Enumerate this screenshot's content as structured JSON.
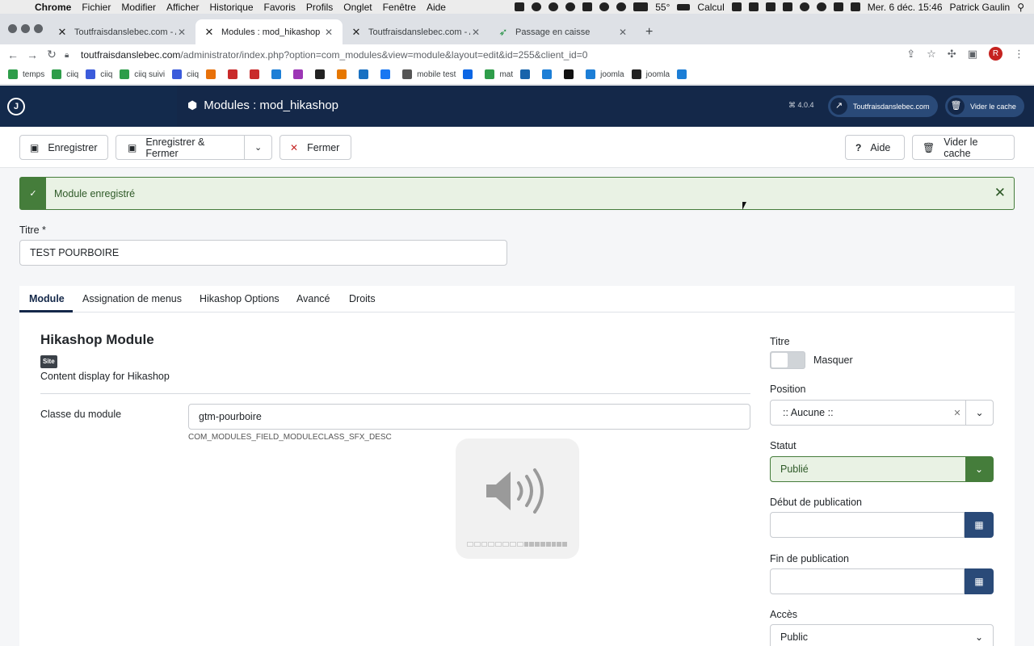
{
  "menubar": {
    "app": "Chrome",
    "items": [
      "Fichier",
      "Modifier",
      "Afficher",
      "Historique",
      "Favoris",
      "Profils",
      "Onglet",
      "Fenêtre",
      "Aide"
    ],
    "temperature": "55°",
    "calc": "Calcul",
    "datetime": "Mer. 6 déc.  15:46",
    "user": "Patrick Gaulin"
  },
  "browser": {
    "tabs": [
      {
        "title": "Toutfraisdanslebec.com - Adm",
        "icon": "joomla-icon"
      },
      {
        "title": "Modules : mod_hikashop - Tou",
        "icon": "joomla-icon",
        "active": true
      },
      {
        "title": "Toutfraisdanslebec.com - Adm",
        "icon": "joomla-icon"
      },
      {
        "title": "Passage en caisse",
        "icon": "hikashop-icon"
      }
    ],
    "url_host": "toutfraisdanslebec.com",
    "url_path": "/administrator/index.php?option=com_modules&view=module&layout=edit&id=255&client_id=0",
    "profile_initial": "R",
    "bookmarks": [
      {
        "label": "temps",
        "color": "#2e9d4a"
      },
      {
        "label": "ciiq",
        "color": "#2e9d4a"
      },
      {
        "label": "ciiq",
        "color": "#3b5bdb"
      },
      {
        "label": "ciiq suivi",
        "color": "#2e9d4a"
      },
      {
        "label": "ciiq",
        "color": "#3b5bdb"
      },
      {
        "label": "",
        "color": "#e8710a"
      },
      {
        "label": "",
        "color": "#c92a2a"
      },
      {
        "label": "",
        "color": "#c92a2a"
      },
      {
        "label": "",
        "color": "#1c7ed6"
      },
      {
        "label": "",
        "color": "#9c36b5"
      },
      {
        "label": "",
        "color": "#222222"
      },
      {
        "label": "",
        "color": "#e67700"
      },
      {
        "label": "",
        "color": "#1971c2"
      },
      {
        "label": "",
        "color": "#1877f2"
      },
      {
        "label": "mobile test",
        "color": "#555555"
      },
      {
        "label": "",
        "color": "#0c66e4"
      },
      {
        "label": "mat",
        "color": "#2e9d4a"
      },
      {
        "label": "",
        "color": "#1864ab"
      },
      {
        "label": "",
        "color": "#1c7ed6"
      },
      {
        "label": "",
        "color": "#111111"
      },
      {
        "label": "joomla",
        "color": "#1c7ed6"
      },
      {
        "label": "joomla",
        "color": "#222222"
      },
      {
        "label": "",
        "color": "#1c7ed6"
      }
    ]
  },
  "header": {
    "title": "Modules : mod_hikashop",
    "version": "⌘ 4.0.4",
    "site_link": "Toutfraisdanslebec.com",
    "clear_cache": "Vider le cache"
  },
  "toolbar": {
    "save": "Enregistrer",
    "save_close": "Enregistrer & Fermer",
    "close": "Fermer",
    "help": "Aide",
    "clear_cache": "Vider le cache"
  },
  "alert": {
    "message": "Module enregistré"
  },
  "title_field": {
    "label": "Titre *",
    "value": "TEST POURBOIRE"
  },
  "tabs": [
    "Module",
    "Assignation de menus",
    "Hikashop Options",
    "Avancé",
    "Droits"
  ],
  "module": {
    "heading": "Hikashop Module",
    "badge": "Site",
    "description": "Content display for Hikashop",
    "class_label": "Classe du module",
    "class_value": "gtm-pourboire",
    "class_help": "COM_MODULES_FIELD_MODULECLASS_SFX_DESC"
  },
  "volume": {
    "level": 0.5
  },
  "sidebar": {
    "titre_label": "Titre",
    "titre_toggle": "Masquer",
    "position_label": "Position",
    "position_value": ":: Aucune ::",
    "statut_label": "Statut",
    "statut_value": "Publié",
    "start_label": "Début de publication",
    "end_label": "Fin de publication",
    "access_label": "Accès",
    "access_value": "Public"
  },
  "colors": {
    "header": "#142849",
    "success": "#457d3b",
    "danger": "#c52827",
    "button_blue": "#2a4a78"
  }
}
